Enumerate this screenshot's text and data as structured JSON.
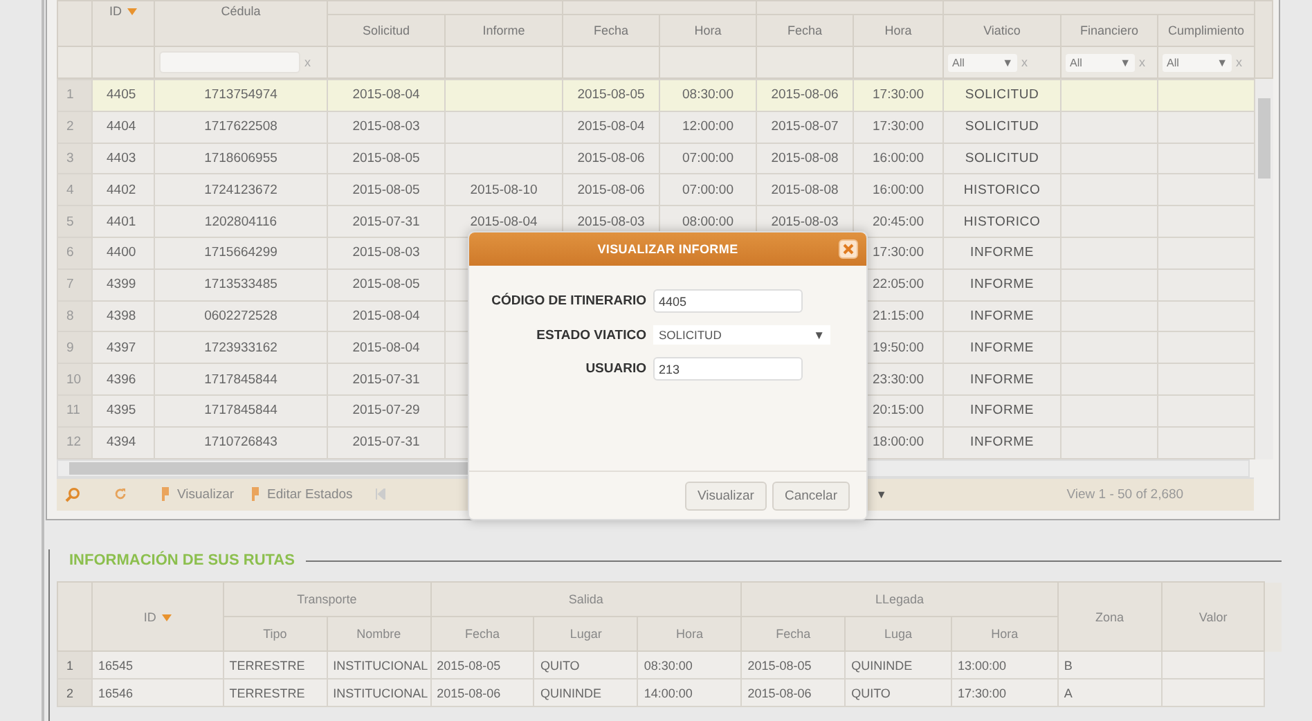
{
  "grid": {
    "columns": [
      {
        "label": "ID",
        "sorted": true
      },
      {
        "label": "Cédula",
        "sorted": false,
        "filter": {
          "kind": "text",
          "clear": "x"
        }
      },
      {
        "label": "Solicitud",
        "sorted": false
      },
      {
        "label": "Informe",
        "sorted": false
      },
      {
        "label": "Fecha",
        "sorted": false
      },
      {
        "label": "Hora",
        "sorted": false
      },
      {
        "label": "Fecha",
        "sorted": false
      },
      {
        "label": "Hora",
        "sorted": false
      },
      {
        "label": "Viatico",
        "sorted": false,
        "filter": {
          "kind": "select",
          "value": "All",
          "arrow": "▼",
          "clear": "x"
        }
      },
      {
        "label": "Financiero",
        "sorted": false,
        "filter": {
          "kind": "select",
          "value": "All",
          "arrow": "▼",
          "clear": "x"
        }
      },
      {
        "label": "Cumplimiento",
        "sorted": false,
        "filter": {
          "kind": "select",
          "value": "All",
          "arrow": "▼",
          "clear": "x"
        }
      }
    ],
    "rows": [
      {
        "number": "1",
        "selected": true,
        "cells": [
          "4405",
          "1713754974",
          "2015-08-04",
          null,
          "2015-08-05",
          "08:30:00",
          "2015-08-06",
          "17:30:00",
          "SOLICITUD",
          null,
          null
        ]
      },
      {
        "number": "2",
        "selected": false,
        "cells": [
          "4404",
          "1717622508",
          "2015-08-03",
          null,
          "2015-08-04",
          "12:00:00",
          "2015-08-07",
          "17:30:00",
          "SOLICITUD",
          null,
          null
        ]
      },
      {
        "number": "3",
        "selected": false,
        "cells": [
          "4403",
          "1718606955",
          "2015-08-05",
          null,
          "2015-08-06",
          "07:00:00",
          "2015-08-08",
          "16:00:00",
          "SOLICITUD",
          null,
          null
        ]
      },
      {
        "number": "4",
        "selected": false,
        "cells": [
          "4402",
          "1724123672",
          "2015-08-05",
          "2015-08-10",
          "2015-08-06",
          "07:00:00",
          "2015-08-08",
          "16:00:00",
          "HISTORICO",
          null,
          null
        ]
      },
      {
        "number": "5",
        "selected": false,
        "cells": [
          "4401",
          "1202804116",
          "2015-07-31",
          "2015-08-04",
          "2015-08-03",
          "08:00:00",
          "2015-08-03",
          "20:45:00",
          "HISTORICO",
          null,
          null
        ]
      },
      {
        "number": "6",
        "selected": false,
        "cells": [
          "4400",
          "1715664299",
          "2015-08-03",
          null,
          null,
          null,
          null,
          "17:30:00",
          "INFORME",
          null,
          null
        ]
      },
      {
        "number": "7",
        "selected": false,
        "cells": [
          "4399",
          "1713533485",
          "2015-08-05",
          null,
          null,
          null,
          null,
          "22:05:00",
          "INFORME",
          null,
          null
        ]
      },
      {
        "number": "8",
        "selected": false,
        "cells": [
          "4398",
          "0602272528",
          "2015-08-04",
          null,
          null,
          null,
          null,
          "21:15:00",
          "INFORME",
          null,
          null
        ]
      },
      {
        "number": "9",
        "selected": false,
        "cells": [
          "4397",
          "1723933162",
          "2015-08-04",
          null,
          null,
          null,
          null,
          "19:50:00",
          "INFORME",
          null,
          null
        ]
      },
      {
        "number": "10",
        "selected": false,
        "cells": [
          "4396",
          "1717845844",
          "2015-07-31",
          null,
          null,
          null,
          null,
          "23:30:00",
          "INFORME",
          null,
          null
        ]
      },
      {
        "number": "11",
        "selected": false,
        "cells": [
          "4395",
          "1717845844",
          "2015-07-29",
          null,
          null,
          null,
          null,
          "20:15:00",
          "INFORME",
          null,
          null
        ]
      },
      {
        "number": "12",
        "selected": false,
        "cells": [
          "4394",
          "1710726843",
          "2015-07-31",
          null,
          null,
          null,
          null,
          "18:00:00",
          "INFORME",
          null,
          null
        ]
      }
    ]
  },
  "pager": {
    "buttons": [
      "Visualizar",
      "Editar Estados"
    ],
    "page_size_arrow": "▼",
    "info": "View 1 - 50 of 2,680"
  },
  "dialog": {
    "title": "VISUALIZAR INFORME",
    "fields": [
      {
        "label": "CÓDIGO DE ITINERARIO",
        "kind": "text",
        "value": "4405"
      },
      {
        "label": "ESTADO VIATICO",
        "kind": "select",
        "value": "SOLICITUD",
        "arrow": "▼"
      },
      {
        "label": "USUARIO",
        "kind": "text",
        "value": "213"
      }
    ],
    "buttons": [
      "Visualizar",
      "Cancelar"
    ]
  },
  "routes": {
    "title": "INFORMACIÓN DE SUS RUTAS",
    "header": [
      {
        "label": "ID",
        "sorted": true
      },
      {
        "label": "Transporte",
        "sorted": false,
        "children": [
          {
            "label": "Tipo"
          },
          {
            "label": "Nombre"
          }
        ]
      },
      {
        "label": "Salida",
        "sorted": false,
        "children": [
          {
            "label": "Fecha"
          },
          {
            "label": "Lugar"
          },
          {
            "label": "Hora"
          }
        ]
      },
      {
        "label": "LLegada",
        "sorted": false,
        "children": [
          {
            "label": "Fecha"
          },
          {
            "label": "Luga"
          },
          {
            "label": "Hora"
          }
        ]
      },
      {
        "label": "Zona",
        "sorted": false
      },
      {
        "label": "Valor",
        "sorted": false
      }
    ],
    "rows": [
      {
        "number": "1",
        "cells": [
          "16545",
          "TERRESTRE",
          "INSTITUCIONAL",
          "2015-08-05",
          "QUITO",
          "08:30:00",
          "2015-08-05",
          "QUININDE",
          "13:00:00",
          "B",
          null
        ]
      },
      {
        "number": "2",
        "cells": [
          "16546",
          "TERRESTRE",
          "INSTITUCIONAL",
          "2015-08-06",
          "QUININDE",
          "14:00:00",
          "2015-08-06",
          "QUITO",
          "17:30:00",
          "A",
          null
        ]
      }
    ]
  }
}
